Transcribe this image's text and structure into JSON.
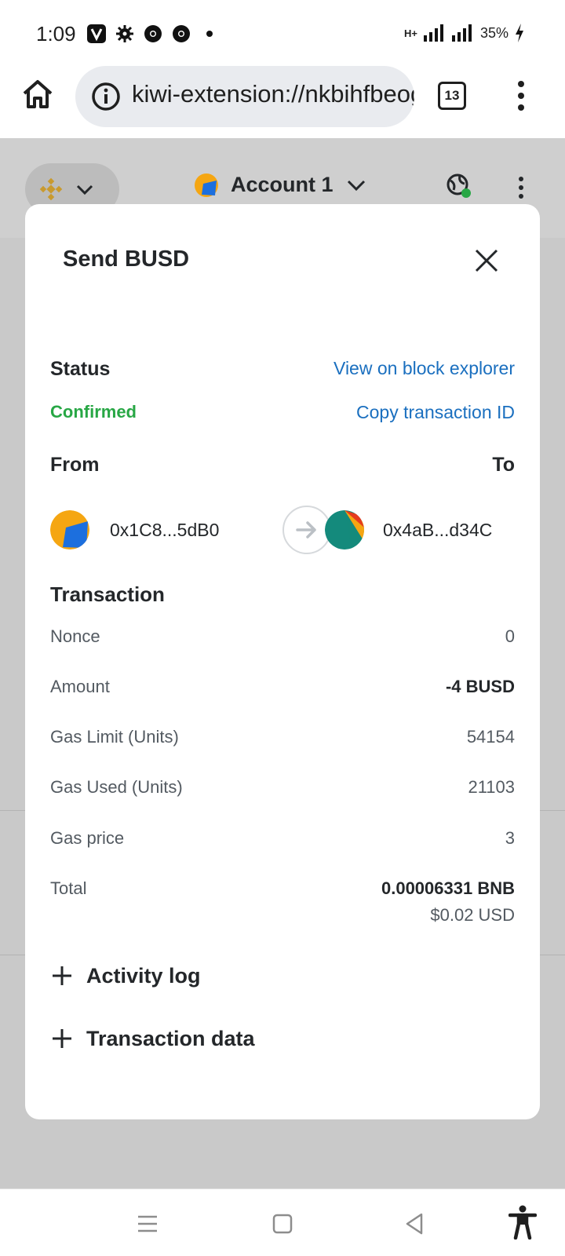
{
  "status_bar": {
    "time": "1:09",
    "network": "H+",
    "battery": "35%",
    "icons": [
      "vivint-icon",
      "gear-icon",
      "chrome-icon",
      "chrome-icon",
      "dot-icon"
    ]
  },
  "browser": {
    "url": "kiwi-extension://nkbihfbeogaeaoehlefnkodbefgpgknn/home.html",
    "tab_count": "13"
  },
  "app_header": {
    "account_name": "Account 1"
  },
  "modal": {
    "title": "Send BUSD",
    "status_label": "Status",
    "status_value": "Confirmed",
    "view_explorer": "View on block explorer",
    "copy_txid": "Copy transaction ID",
    "from_label": "From",
    "to_label": "To",
    "from_address": "0x1C8...5dB0",
    "to_address": "0x4aB...d34C",
    "transaction_title": "Transaction",
    "rows": [
      {
        "label": "Nonce",
        "value": "0"
      },
      {
        "label": "Amount",
        "value": "-4 BUSD"
      },
      {
        "label": "Gas Limit (Units)",
        "value": "54154"
      },
      {
        "label": "Gas Used (Units)",
        "value": "21103"
      },
      {
        "label": "Gas price",
        "value": "3"
      },
      {
        "label": "Total",
        "value": "0.00006331 BNB"
      }
    ],
    "total_usd": "$0.02 USD",
    "activity_log": "Activity log",
    "transaction_data": "Transaction data"
  },
  "colors": {
    "confirmed": "#28a745",
    "link": "#1a6fbf",
    "backdrop": "#c9c9c9"
  }
}
